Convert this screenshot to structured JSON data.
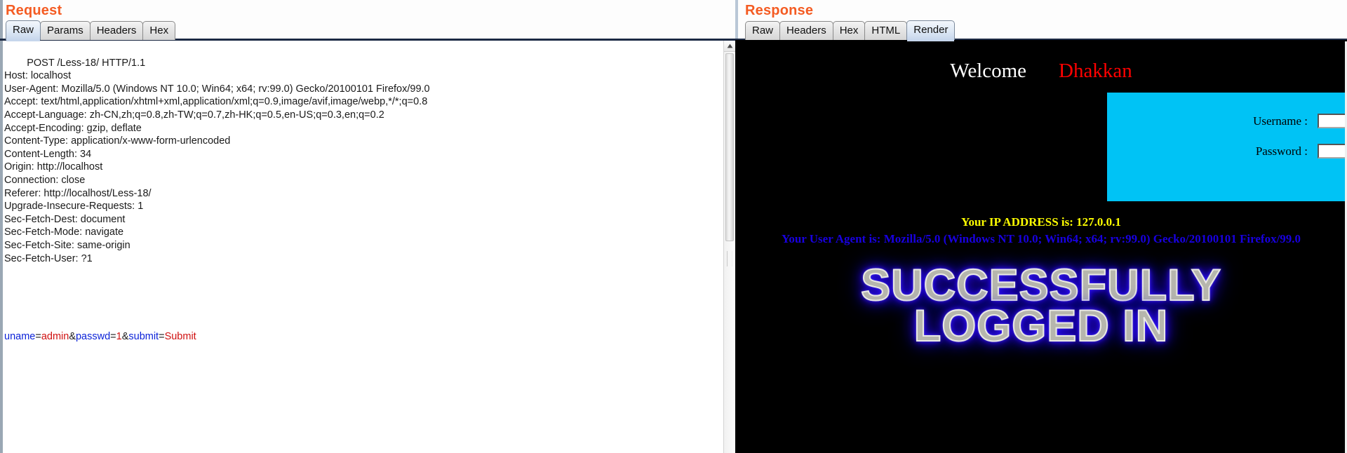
{
  "request": {
    "title": "Request",
    "tabs": [
      {
        "label": "Raw",
        "active": true
      },
      {
        "label": "Params",
        "active": false
      },
      {
        "label": "Headers",
        "active": false
      },
      {
        "label": "Hex",
        "active": false
      }
    ],
    "raw_lines": [
      "POST /Less-18/ HTTP/1.1",
      "Host: localhost",
      "User-Agent: Mozilla/5.0 (Windows NT 10.0; Win64; x64; rv:99.0) Gecko/20100101 Firefox/99.0",
      "Accept: text/html,application/xhtml+xml,application/xml;q=0.9,image/avif,image/webp,*/*;q=0.8",
      "Accept-Language: zh-CN,zh;q=0.8,zh-TW;q=0.7,zh-HK;q=0.5,en-US;q=0.3,en;q=0.2",
      "Accept-Encoding: gzip, deflate",
      "Content-Type: application/x-www-form-urlencoded",
      "Content-Length: 34",
      "Origin: http://localhost",
      "Connection: close",
      "Referer: http://localhost/Less-18/",
      "Upgrade-Insecure-Requests: 1",
      "Sec-Fetch-Dest: document",
      "Sec-Fetch-Mode: navigate",
      "Sec-Fetch-Site: same-origin",
      "Sec-Fetch-User: ?1"
    ],
    "body_params": [
      {
        "name": "uname",
        "value": "admin",
        "sep": "&"
      },
      {
        "name": "passwd",
        "value": "1",
        "sep": "&"
      },
      {
        "name": "submit",
        "value": "Submit",
        "sep": ""
      }
    ],
    "body_raw": "uname=admin&passwd=1&submit=Submit",
    "scrollbar": {
      "up_arrow_icon": "triangle-up-icon"
    }
  },
  "response": {
    "title": "Response",
    "tabs": [
      {
        "label": "Raw",
        "active": false
      },
      {
        "label": "Headers",
        "active": false
      },
      {
        "label": "Hex",
        "active": false
      },
      {
        "label": "HTML",
        "active": false
      },
      {
        "label": "Render",
        "active": true
      }
    ],
    "render": {
      "welcome_text": "Welcome",
      "welcome_user": "Dhakkan",
      "login_box_color": "#00c3f5",
      "fields": [
        {
          "label": "Username :",
          "value": ""
        },
        {
          "label": "Password :",
          "value": ""
        }
      ],
      "ip_line": "Your IP ADDRESS is: 127.0.0.1",
      "ip_color": "#ffff00",
      "user_agent_line": "Your User Agent is: Mozilla/5.0 (Windows NT 10.0; Win64; x64; rv:99.0) Gecko/20100101 Firefox/99.0",
      "user_agent_color": "#1800e0",
      "banner_lines": [
        "SUCCESSFULLY",
        "LOGGED IN"
      ],
      "banner_glow_color": "#2a0cff",
      "banner_fill_color": "#b6b6ad"
    }
  },
  "colors": {
    "panel_title": "#f45b22",
    "param_name": "#0b22d8",
    "param_value": "#d01010",
    "page_background": "#000000"
  }
}
